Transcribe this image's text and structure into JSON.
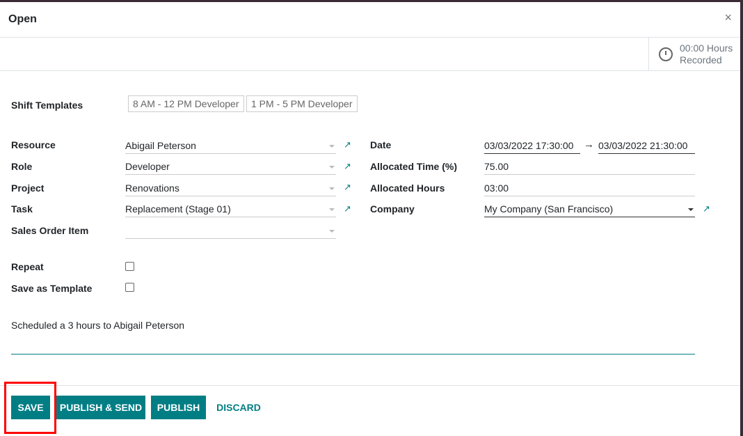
{
  "dialog": {
    "title": "Open",
    "close": "×"
  },
  "stat": {
    "value": "00:00 Hours",
    "label": "Recorded",
    "icon": "clock-icon"
  },
  "shift_templates": {
    "label": "Shift Templates",
    "items": [
      "8 AM - 12 PM Developer",
      "1 PM - 5 PM Developer"
    ]
  },
  "left": [
    {
      "label": "Resource",
      "value": "Abigail Peterson"
    },
    {
      "label": "Role",
      "value": "Developer"
    },
    {
      "label": "Project",
      "value": "Renovations"
    },
    {
      "label": "Task",
      "value": "Replacement (Stage 01)"
    },
    {
      "label": "Sales Order Item",
      "value": ""
    }
  ],
  "right": {
    "date_label": "Date",
    "date_start": "03/03/2022 17:30:00",
    "date_arrow": "→",
    "date_end": "03/03/2022 21:30:00",
    "alloc_time_label": "Allocated Time (%)",
    "alloc_time": "75.00",
    "alloc_hours_label": "Allocated Hours",
    "alloc_hours": "03:00",
    "company_label": "Company",
    "company": "My Company (San Francisco)"
  },
  "repeat": {
    "label": "Repeat",
    "checked": false
  },
  "save_template": {
    "label": "Save as Template",
    "checked": false
  },
  "note": "Scheduled a 3 hours to Abigail Peterson",
  "buttons": {
    "save": "SAVE",
    "publish_send": "PUBLISH & SEND",
    "publish": "PUBLISH",
    "discard": "DISCARD"
  },
  "colors": {
    "primary": "#017e84",
    "highlight": "#ff0000"
  }
}
